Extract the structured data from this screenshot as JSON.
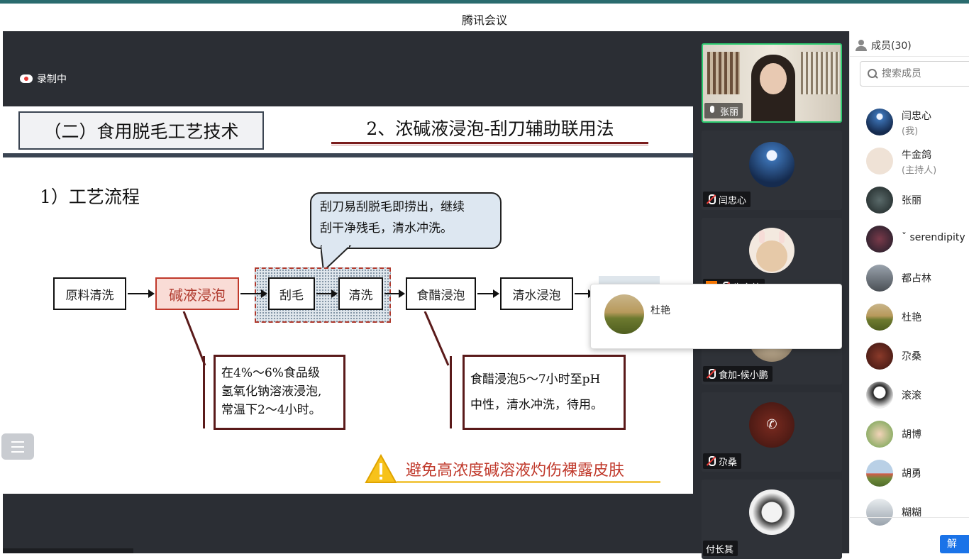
{
  "window": {
    "title": "腾讯会议"
  },
  "recording": {
    "label": "录制中"
  },
  "slide": {
    "section": "（二）食用脱毛工艺技术",
    "title": "2、浓碱液浸泡-刮刀辅助联用法",
    "subtitle": "1）工艺流程",
    "steps": [
      "原料清洗",
      "碱液浸泡",
      "刮毛",
      "清洗",
      "食醋浸泡",
      "清水浸泡"
    ],
    "bubble_lines": [
      "刮刀易刮脱毛即捞出，继续",
      "刮干净残毛，清水冲洗。"
    ],
    "note1_lines": [
      "在4%～6%食品级",
      "氢氧化钠溶液浸泡,",
      "常温下2～4小时。"
    ],
    "note2_lines": [
      "食醋浸泡5～7小时至pH",
      "中性，清水冲洗，待用。"
    ],
    "warning": "避免高浓度碱溶液灼伤裸露皮肤",
    "accent_red": "#c0392b",
    "highlight_fill": "#f9dcd6"
  },
  "videos": [
    {
      "name": "张丽",
      "mic": "on",
      "active": true
    },
    {
      "name": "闫忠心",
      "mic": "off"
    },
    {
      "name": "牛金鸽",
      "mic": "off"
    },
    {
      "name": "食加-候小鹏",
      "mic": "off"
    },
    {
      "name": "尕桑",
      "mic": "off",
      "icon": "phone-icon"
    },
    {
      "name": "付长其",
      "mic": "none"
    }
  ],
  "popup": {
    "name": "杜艳"
  },
  "members": {
    "header": "成员(30)",
    "search_placeholder": "搜索成员",
    "list": [
      {
        "name": "闫忠心",
        "note": "(我)"
      },
      {
        "name": "牛金鸽",
        "note": "(主持人)"
      },
      {
        "name": "张丽"
      },
      {
        "name": "ˇ serendipity"
      },
      {
        "name": "都占林"
      },
      {
        "name": "杜艳"
      },
      {
        "name": "尕桑"
      },
      {
        "name": "滚滚"
      },
      {
        "name": "胡博"
      },
      {
        "name": "胡勇"
      },
      {
        "name": "糊糊"
      }
    ],
    "unmute_button": "解"
  }
}
